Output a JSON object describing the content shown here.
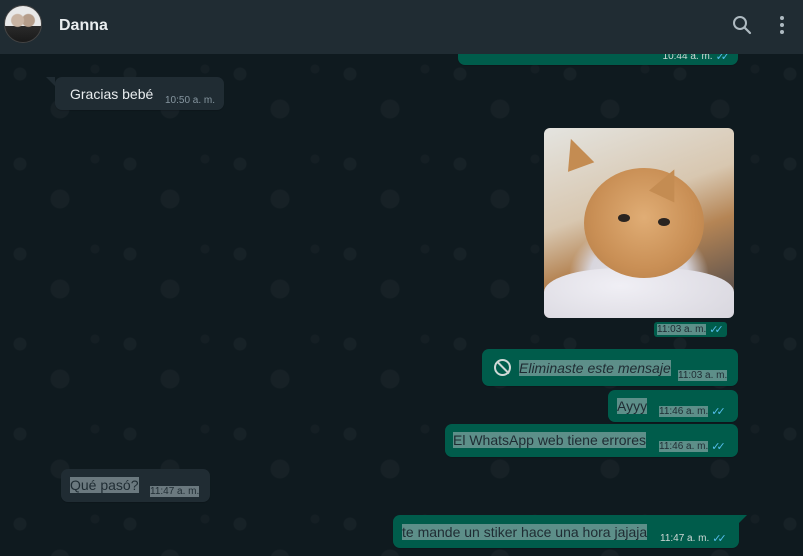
{
  "header": {
    "contact_name": "Danna",
    "search_icon": "search-icon",
    "menu_icon": "kebab-menu-icon"
  },
  "colors": {
    "header_bg": "#202c33",
    "incoming_bubble": "#202c33",
    "outgoing_bubble": "#005c4b",
    "read_ticks": "#53bdeb"
  },
  "messages": [
    {
      "direction": "out",
      "text": "",
      "time": "10:44 a. m.",
      "ticks": "✓✓",
      "note": "partially scrolled out of view"
    },
    {
      "direction": "in",
      "text": "Gracias bebé",
      "time": "10:50 a. m."
    },
    {
      "direction": "out",
      "type": "image",
      "image_icon": "kitten-photo",
      "time": "11:03 a. m.",
      "ticks": "✓✓"
    },
    {
      "direction": "out",
      "type": "deleted",
      "text": "Eliminaste este mensaje",
      "time": "11:03 a. m."
    },
    {
      "direction": "out",
      "text": "Ayyy",
      "time": "11:46 a. m.",
      "ticks": "✓✓"
    },
    {
      "direction": "out",
      "text": "El WhatsApp web tiene errores",
      "time": "11:46 a. m.",
      "ticks": "✓✓"
    },
    {
      "direction": "in",
      "text": "Qué pasó?",
      "time": "11:47 a. m."
    },
    {
      "direction": "out",
      "text": "te mande un stiker hace una hora jajaja",
      "time": "11:47 a. m.",
      "ticks": "✓✓"
    }
  ]
}
